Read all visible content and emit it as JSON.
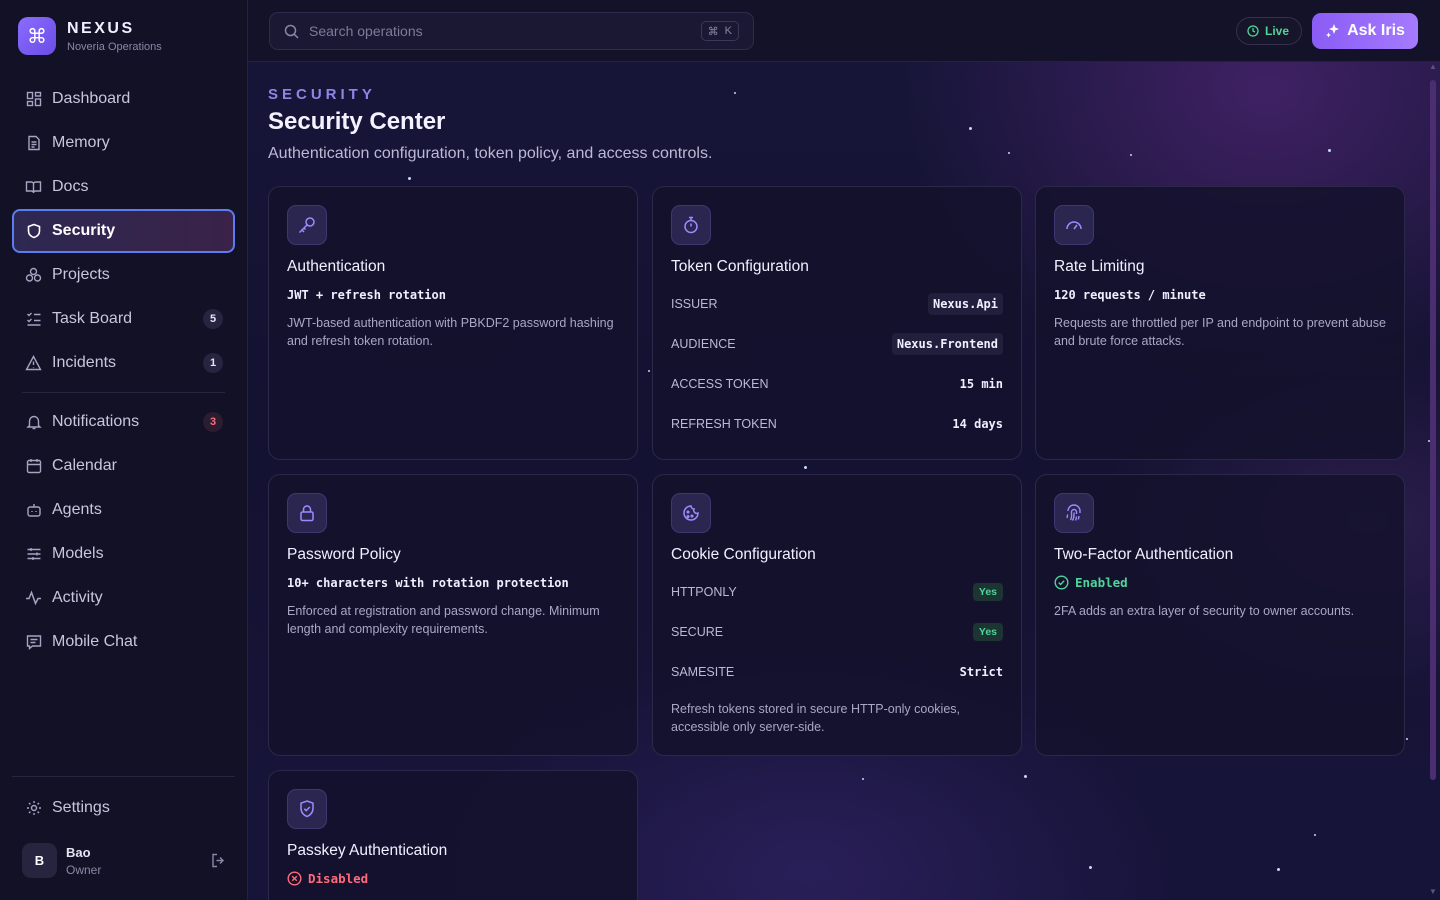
{
  "brand": {
    "name": "NEXUS",
    "subtitle": "Noveria Operations"
  },
  "nav": {
    "items": [
      {
        "label": "Dashboard"
      },
      {
        "label": "Memory"
      },
      {
        "label": "Docs"
      },
      {
        "label": "Security"
      },
      {
        "label": "Projects"
      },
      {
        "label": "Task Board",
        "badge": "5"
      },
      {
        "label": "Incidents",
        "badge": "1"
      },
      {
        "label": "Notifications",
        "badge": "3"
      },
      {
        "label": "Calendar"
      },
      {
        "label": "Agents"
      },
      {
        "label": "Models"
      },
      {
        "label": "Activity"
      },
      {
        "label": "Mobile Chat"
      }
    ],
    "settings": "Settings"
  },
  "user": {
    "initial": "B",
    "name": "Bao",
    "role": "Owner"
  },
  "topbar": {
    "search_placeholder": "Search operations",
    "shortcut_symbol": "⌘",
    "shortcut_key": "K",
    "live_label": "Live",
    "ask_label": "Ask Iris"
  },
  "page": {
    "eyebrow": "SECURITY",
    "title": "Security Center",
    "subtitle": "Authentication configuration, token policy, and access controls."
  },
  "cards": {
    "auth": {
      "title": "Authentication",
      "value": "JWT + refresh rotation",
      "desc": "JWT-based authentication with PBKDF2 password hashing and refresh token rotation."
    },
    "token": {
      "title": "Token Configuration",
      "rows": [
        {
          "key": "Issuer",
          "value": "Nexus.Api"
        },
        {
          "key": "Audience",
          "value": "Nexus.Frontend"
        },
        {
          "key": "Access Token",
          "value": "15 min"
        },
        {
          "key": "Refresh Token",
          "value": "14 days"
        }
      ]
    },
    "rate": {
      "title": "Rate Limiting",
      "value": "120 requests / minute",
      "desc": "Requests are throttled per IP and endpoint to prevent abuse and brute force attacks."
    },
    "password": {
      "title": "Password Policy",
      "value": "10+ characters with rotation protection",
      "desc": "Enforced at registration and password change. Minimum length and complexity requirements."
    },
    "cookie": {
      "title": "Cookie Configuration",
      "rows": [
        {
          "key": "HttpOnly",
          "value": "Yes"
        },
        {
          "key": "Secure",
          "value": "Yes"
        },
        {
          "key": "SameSite",
          "value": "Strict"
        }
      ],
      "desc": "Refresh tokens stored in secure HTTP-only cookies, accessible only server-side."
    },
    "twofa": {
      "title": "Two-Factor Authentication",
      "status": "Enabled",
      "desc": "2FA adds an extra layer of security to owner accounts."
    },
    "passkey": {
      "title": "Passkey Authentication",
      "status": "Disabled"
    }
  },
  "colors": {
    "accent": "#8b6cff",
    "active_border": "#5c7cf2",
    "success": "#4ed59a",
    "danger": "#ff6b7a",
    "background": "#141231"
  }
}
